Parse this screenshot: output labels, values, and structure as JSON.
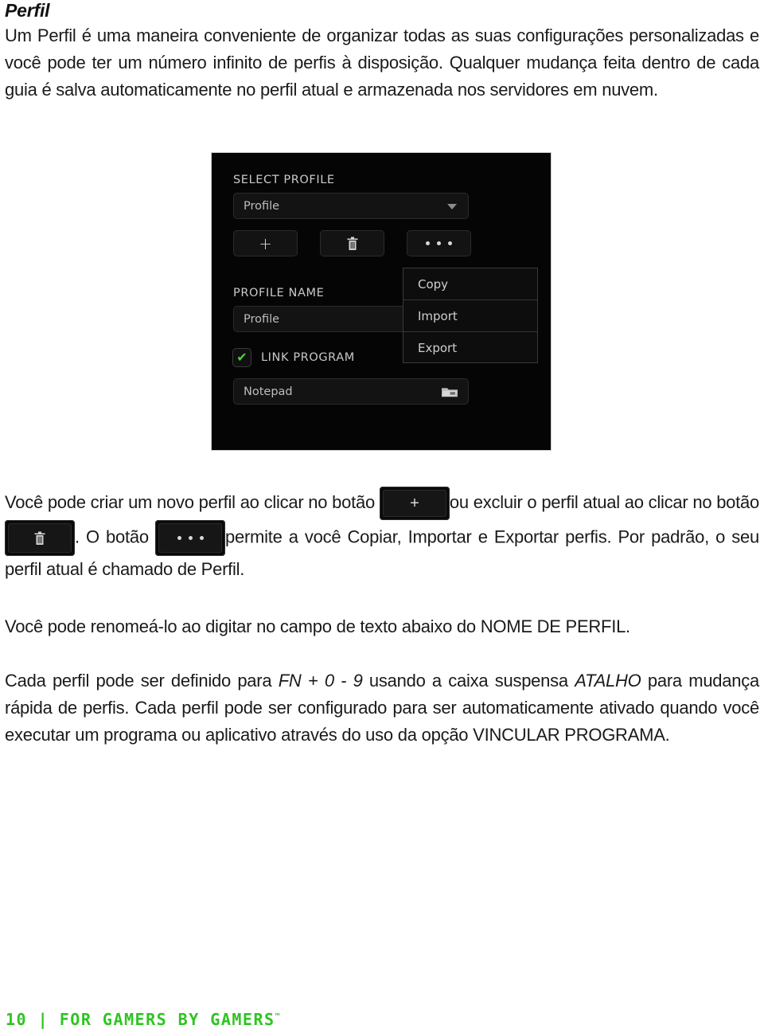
{
  "document": {
    "title": "Perfil",
    "paragraphs": [
      {
        "id": "p1",
        "text": "Um Perfil é uma maneira conveniente de organizar todas as suas configurações personalizadas e você pode ter um número infinito de perfis à disposição. Qualquer mudança feita dentro de cada guia é salva automaticamente no perfil atual e armazenada nos servidores em nuvem."
      },
      {
        "id": "p3a",
        "text_before_plus": "Você pode criar um novo perfil ao clicar no botão ",
        "text_after_plus": "ou excluir o perfil atual ao clicar no botão ",
        "text_after_trash": ". O botão ",
        "text_after_dots": "permite a você Copiar, Importar e Exportar perfis. Por padrão, o seu perfil atual é chamado de Perfil."
      },
      {
        "id": "p4",
        "text": "Você pode renomeá-lo ao digitar no campo de texto abaixo do NOME DE PERFIL."
      },
      {
        "id": "p5",
        "part1": "Cada perfil pode ser definido para ",
        "em1": "FN + 0 - 9",
        "part2": " usando a caixa suspensa ",
        "em2": "ATALHO",
        "part3": " para mudança rápida de perfis. Cada perfil pode ser configurado para ser automaticamente ativado quando você executar um programa ou aplicativo através do uso da opção VINCULAR PROGRAMA."
      }
    ]
  },
  "inline_buttons": {
    "add_profile": {
      "icon": "plus-icon",
      "glyph": "+"
    },
    "delete_profile": {
      "icon": "trash-icon"
    },
    "more_options": {
      "icon": "ellipsis-icon"
    }
  },
  "app_panel": {
    "select_profile_label": "SELECT PROFILE",
    "profile_dropdown": {
      "value": "Profile",
      "caret_icon": "chevron-down-icon"
    },
    "buttons": {
      "add": {
        "name": "add-profile-button",
        "glyph": "+"
      },
      "delete": {
        "name": "delete-profile-button",
        "icon": "trash-icon"
      },
      "more": {
        "name": "more-options-button",
        "icon": "ellipsis-icon"
      }
    },
    "context_menu": {
      "items": [
        {
          "label": "Copy"
        },
        {
          "label": "Import"
        },
        {
          "label": "Export"
        }
      ]
    },
    "profile_name_label": "PROFILE NAME",
    "profile_name_value": "Profile",
    "link_program": {
      "label": "LINK PROGRAM",
      "checked": true,
      "check_glyph": "✔",
      "accent_color": "#44d62c"
    },
    "linked_program": {
      "value": "Notepad",
      "browse_icon": "folder-icon"
    }
  },
  "footer": {
    "page_number": "10",
    "separator": "|",
    "tagline": "FOR GAMERS BY GAMERS",
    "trademark": "™",
    "color": "#2fc422"
  }
}
